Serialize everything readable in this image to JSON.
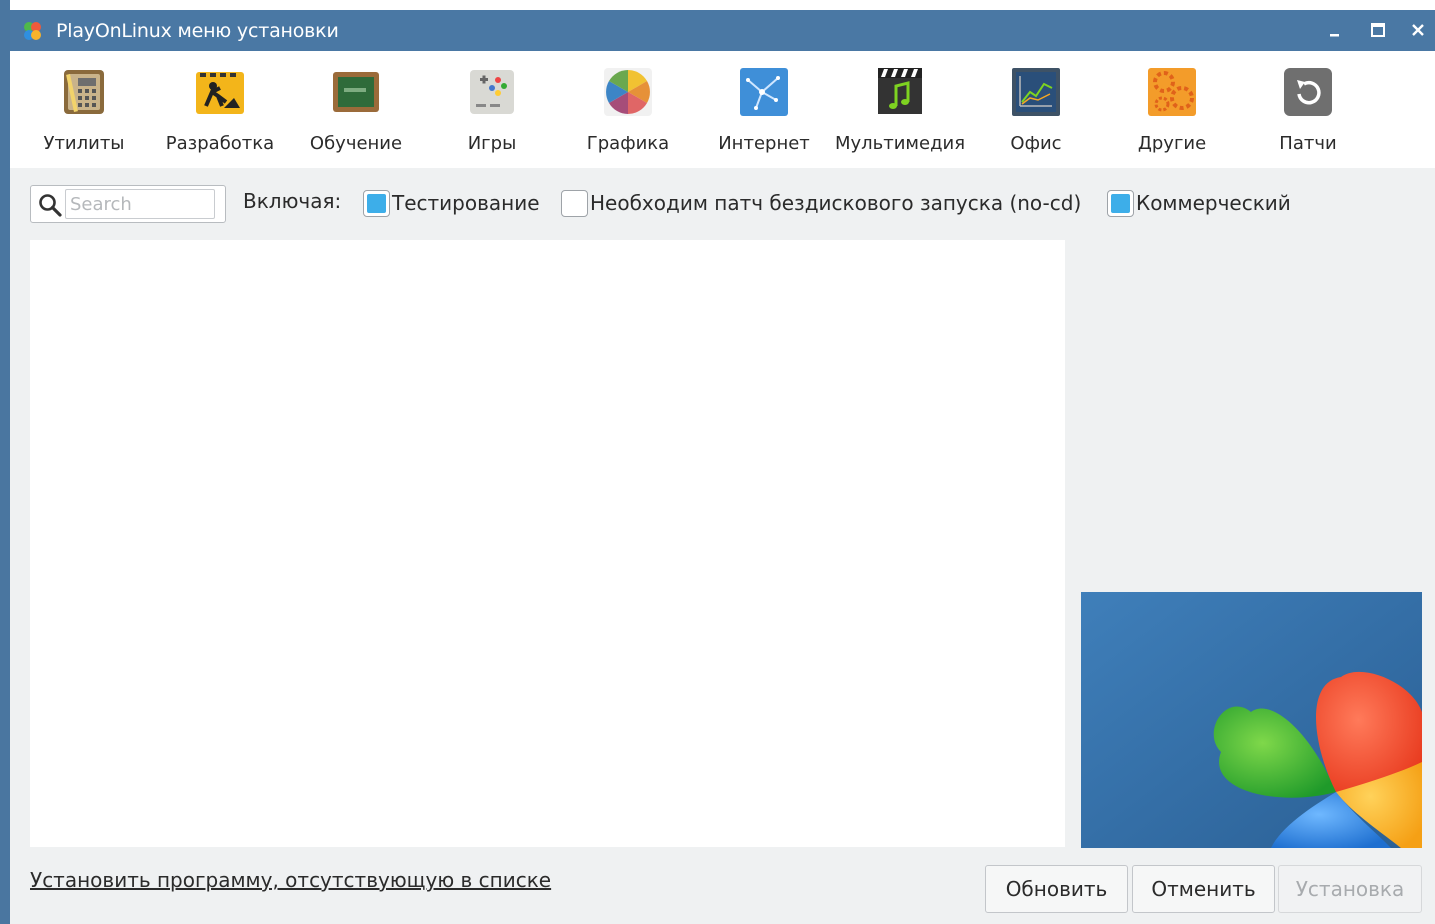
{
  "window": {
    "title": "PlayOnLinux меню установки",
    "controls": {
      "minimize": "minimize-icon",
      "maximize": "maximize-icon",
      "close": "close-icon"
    }
  },
  "categories": [
    {
      "label": "Утилиты",
      "icon": "utilities-icon"
    },
    {
      "label": "Разработка",
      "icon": "development-icon"
    },
    {
      "label": "Обучение",
      "icon": "education-icon"
    },
    {
      "label": "Игры",
      "icon": "games-icon"
    },
    {
      "label": "Графика",
      "icon": "graphics-icon"
    },
    {
      "label": "Интернет",
      "icon": "internet-icon"
    },
    {
      "label": "Мультимедия",
      "icon": "multimedia-icon"
    },
    {
      "label": "Офис",
      "icon": "office-icon"
    },
    {
      "label": "Другие",
      "icon": "other-icon"
    },
    {
      "label": "Патчи",
      "icon": "patches-icon"
    }
  ],
  "filters": {
    "search": {
      "placeholder": "Search",
      "value": ""
    },
    "including_label": "Включая:",
    "testing": {
      "label": "Тестирование",
      "checked": true
    },
    "nocd": {
      "label": "Необходим патч бездискового запуска (no-cd)",
      "checked": false
    },
    "commercial": {
      "label": "Коммерческий",
      "checked": true
    }
  },
  "apps_list": [],
  "footer": {
    "install_other_link": "Установить программу, отсутствующую в списке",
    "refresh_label": "Обновить",
    "cancel_label": "Отменить",
    "install_label": "Установка"
  },
  "colors": {
    "titlebar": "#4a78a4",
    "checkbox_accent": "#3daee9",
    "window_bg": "#eff1f2"
  }
}
